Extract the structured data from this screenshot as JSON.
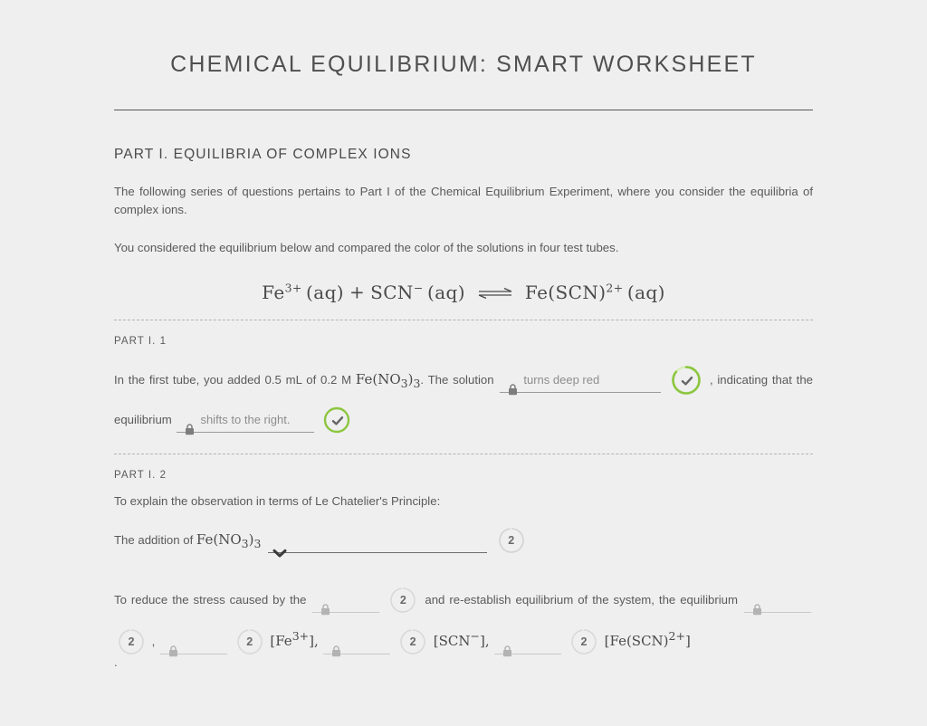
{
  "document": {
    "title": "CHEMICAL EQUILIBRIUM: SMART WORKSHEET"
  },
  "part1": {
    "heading": "PART I. EQUILIBRIA OF COMPLEX IONS",
    "intro_paragraph": "The following series of questions pertains to Part I of the Chemical Equilibrium Experiment, where you consider the equilibria of complex ions.",
    "second_paragraph": "You considered the equilibrium below and compared the color of the solutions in four test tubes.",
    "equation": {
      "reactant1": "Fe",
      "reactant1_charge": "3+",
      "reactant1_state": "(aq)",
      "plus": "+",
      "reactant2": "SCN",
      "reactant2_charge": "−",
      "reactant2_state": "(aq)",
      "arrow": "equilibrium-arrow",
      "product": "Fe(SCN)",
      "product_charge": "2+",
      "product_state": "(aq)"
    }
  },
  "question1": {
    "label": "PART I. 1",
    "text_before_field1": "In the first tube, you added 0.5 mL of 0.2 M ",
    "formula1": "Fe(NO",
    "formula1_sub": "3",
    "formula1_close": ")",
    "formula1_sub2": "3",
    "text_after_formula1": ". The solution",
    "field1": {
      "value": "turns deep red",
      "placeholder": "turns deep red",
      "locked": true,
      "lock_icon": "lock-icon"
    },
    "badge1": {
      "type": "check",
      "icon": "check-icon",
      "ring_color": "#8cc63f",
      "track_color": "#d8edbc"
    },
    "text_mid": ", indicating that the",
    "text_before_field2": "equilibrium",
    "field2": {
      "value": "shifts to the right.",
      "placeholder": "shifts to the right.",
      "locked": true,
      "lock_icon": "lock-icon"
    },
    "badge2": {
      "type": "check",
      "icon": "check-icon",
      "ring_color": "#8cc63f",
      "track_color": "#8cc63f"
    }
  },
  "question2": {
    "label": "PART I. 2",
    "prompt": "To explain the observation in terms of Le Chatelier's Principle:",
    "line1_before": "The addition of ",
    "line1_formula": "Fe(NO",
    "line1_sub": "3",
    "line1_close": ")",
    "line1_sub2": "3",
    "dropdown": {
      "value": "",
      "placeholder": "",
      "icon": "chevron-down-icon"
    },
    "dropdown_points": "2",
    "line2_before": "To reduce the stress caused by the",
    "blank1": {
      "value": "",
      "locked": true,
      "lock_icon": "lock-icon"
    },
    "blank1_points": "2",
    "line2_mid": "and re-establish equilibrium of the system, the equilibrium",
    "blank2": {
      "value": "",
      "locked": true,
      "lock_icon": "lock-icon"
    },
    "blank2_points": "2",
    "comma1": ",",
    "blank3": {
      "value": "",
      "locked": true,
      "lock_icon": "lock-icon"
    },
    "blank3_points": "2",
    "species1": "[Fe",
    "species1_charge": "3+",
    "species1_close": "],",
    "blank4": {
      "value": "",
      "locked": true,
      "lock_icon": "lock-icon"
    },
    "blank4_points": "2",
    "species2": "[SCN",
    "species2_charge": "−",
    "species2_close": "],",
    "blank5": {
      "value": "",
      "locked": true,
      "lock_icon": "lock-icon"
    },
    "blank5_points": "2",
    "species3": "[Fe(SCN)",
    "species3_charge": "2+",
    "species3_close": "]",
    "trailing": "."
  },
  "colors": {
    "page_background": "#efefef",
    "text": "#5a5a5a",
    "heading": "#4a4a4a",
    "rule": "#58585a",
    "dashed_divider": "#b4b4b4",
    "field_underline": "#9a9a9a",
    "field_underline_light": "#c9c9c9",
    "placeholder": "#8d8d8d",
    "accent_green": "#8cc63f",
    "badge_ring_gray": "#d2d2d2",
    "lock_icon": "#8b8b8b"
  }
}
